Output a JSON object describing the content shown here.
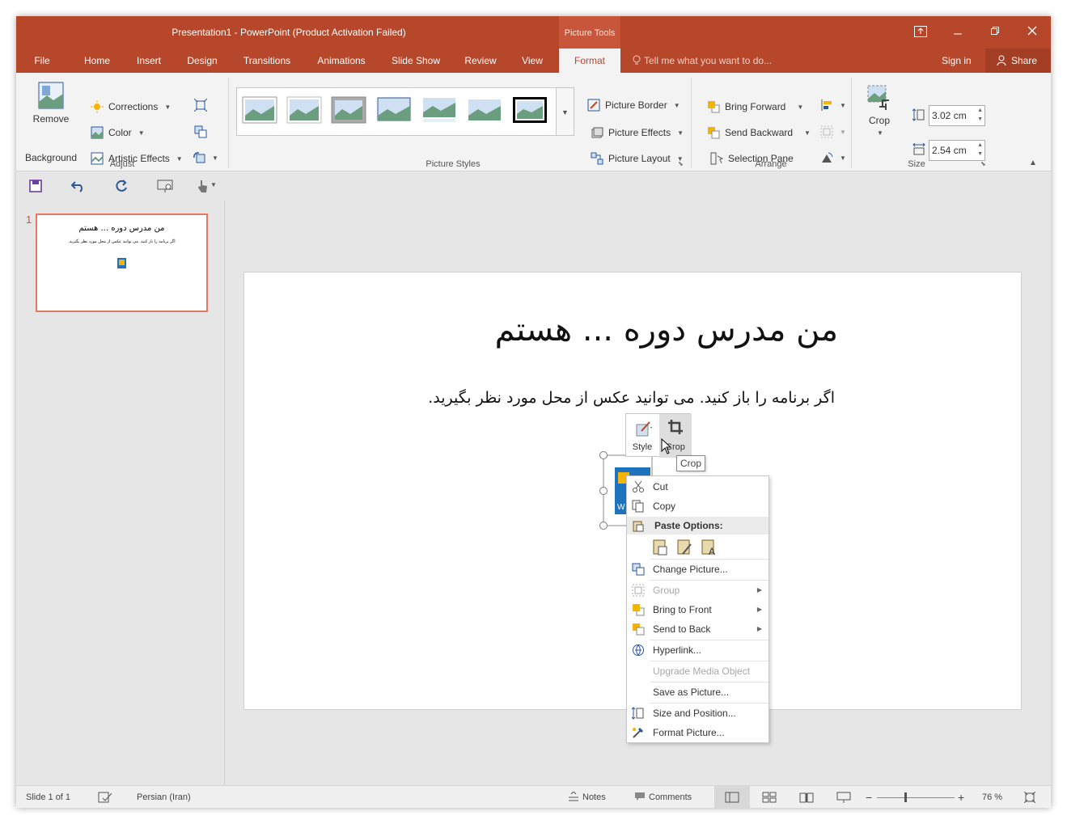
{
  "window": {
    "title": "Presentation1 - PowerPoint (Product Activation Failed)",
    "context_tab": "Picture Tools"
  },
  "tabs": [
    "File",
    "Home",
    "Insert",
    "Design",
    "Transitions",
    "Animations",
    "Slide Show",
    "Review",
    "View",
    "Format"
  ],
  "active_tab": "Format",
  "tell_me": "Tell me what you want to do...",
  "sign_in": "Sign in",
  "share": "Share",
  "ribbon": {
    "adjust": {
      "label": "Adjust",
      "remove_bg_line1": "Remove",
      "remove_bg_line2": "Background",
      "corrections": "Corrections",
      "color": "Color",
      "artistic": "Artistic Effects"
    },
    "styles": {
      "label": "Picture Styles",
      "border": "Picture Border",
      "effects": "Picture Effects",
      "layout": "Picture Layout"
    },
    "arrange": {
      "label": "Arrange",
      "bring_forward": "Bring Forward",
      "send_backward": "Send Backward",
      "selection_pane": "Selection Pane"
    },
    "size": {
      "label": "Size",
      "crop": "Crop",
      "height": "3.02 cm",
      "width": "2.54 cm"
    }
  },
  "thumbnail": {
    "number": "1",
    "title": "من مدرس دوره ... هستم",
    "body": "اگر برنامه را باز کنید. می توانید عکس از محل مورد نظر بگیرید."
  },
  "slide": {
    "title": "من مدرس دوره ... هستم",
    "body": "اگر برنامه را باز کنید. می توانید عکس از محل مورد نظر بگیرید."
  },
  "minitoolbar": {
    "style": "Style",
    "crop": "Crop",
    "tooltip": "Crop"
  },
  "context_menu": {
    "cut": "Cut",
    "copy": "Copy",
    "paste_options": "Paste Options:",
    "change_picture": "Change Picture...",
    "group": "Group",
    "bring_to_front": "Bring to Front",
    "send_to_back": "Send to Back",
    "hyperlink": "Hyperlink...",
    "upgrade_media": "Upgrade Media Object",
    "save_as_picture": "Save as Picture...",
    "size_position": "Size and Position...",
    "format_picture": "Format Picture..."
  },
  "status": {
    "slide": "Slide 1 of 1",
    "language": "Persian (Iran)",
    "notes": "Notes",
    "comments": "Comments",
    "zoom": "76 %"
  },
  "colors": {
    "accent": "#b7472a",
    "ribbon": "#f3f3f3",
    "thumb_border": "#e07b5f"
  }
}
